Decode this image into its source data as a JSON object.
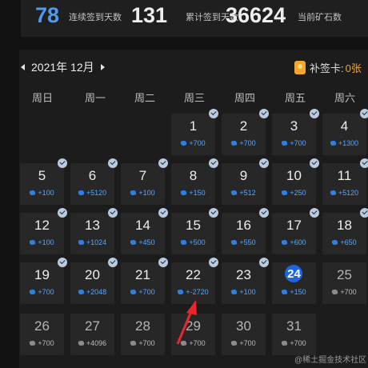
{
  "stats": {
    "streak_value": "78",
    "streak_label": "连续签到天数",
    "total_value": "131",
    "total_label": "累计签到天数",
    "ore_value": "36624",
    "ore_label": "当前矿石数",
    "streak_color": "#4e9af1"
  },
  "calendar": {
    "month_label": "2021年 12月",
    "makeup_label": "补签卡:",
    "makeup_count": "0张",
    "weekdays": [
      "周日",
      "周一",
      "周二",
      "周三",
      "周四",
      "周五",
      "周六"
    ],
    "days": [
      {
        "day": "1",
        "reward": "+700",
        "signed": true
      },
      {
        "day": "2",
        "reward": "+700",
        "signed": true
      },
      {
        "day": "3",
        "reward": "+700",
        "signed": true
      },
      {
        "day": "4",
        "reward": "+1300",
        "signed": true
      },
      {
        "day": "5",
        "reward": "+100",
        "signed": true
      },
      {
        "day": "6",
        "reward": "+5120",
        "signed": true
      },
      {
        "day": "7",
        "reward": "+100",
        "signed": true
      },
      {
        "day": "8",
        "reward": "+150",
        "signed": true
      },
      {
        "day": "9",
        "reward": "+512",
        "signed": true
      },
      {
        "day": "10",
        "reward": "+250",
        "signed": true
      },
      {
        "day": "11",
        "reward": "+5120",
        "signed": true
      },
      {
        "day": "12",
        "reward": "+100",
        "signed": true
      },
      {
        "day": "13",
        "reward": "+1024",
        "signed": true
      },
      {
        "day": "14",
        "reward": "+450",
        "signed": true
      },
      {
        "day": "15",
        "reward": "+500",
        "signed": true
      },
      {
        "day": "16",
        "reward": "+550",
        "signed": true
      },
      {
        "day": "17",
        "reward": "+600",
        "signed": true
      },
      {
        "day": "18",
        "reward": "+650",
        "signed": true
      },
      {
        "day": "19",
        "reward": "+700",
        "signed": true
      },
      {
        "day": "20",
        "reward": "+2048",
        "signed": true
      },
      {
        "day": "21",
        "reward": "+700",
        "signed": true
      },
      {
        "day": "22",
        "reward": "+-2720",
        "signed": true
      },
      {
        "day": "23",
        "reward": "+100",
        "signed": true
      },
      {
        "day": "24",
        "reward": "+150",
        "signed": true,
        "today": true
      },
      {
        "day": "25",
        "reward": "+700",
        "signed": false
      },
      {
        "day": "26",
        "reward": "+700",
        "signed": false
      },
      {
        "day": "27",
        "reward": "+4096",
        "signed": false
      },
      {
        "day": "28",
        "reward": "+700",
        "signed": false
      },
      {
        "day": "29",
        "reward": "+700",
        "signed": false
      },
      {
        "day": "30",
        "reward": "+700",
        "signed": false
      },
      {
        "day": "31",
        "reward": "+700",
        "signed": false
      }
    ],
    "ore_color_signed": "#2f7fe0",
    "ore_color_future": "#8c8c8c",
    "today_color": "#1e66e0"
  },
  "watermark": "@稀土掘金技术社区",
  "annotation": {
    "arrow_color": "#e8262c"
  }
}
